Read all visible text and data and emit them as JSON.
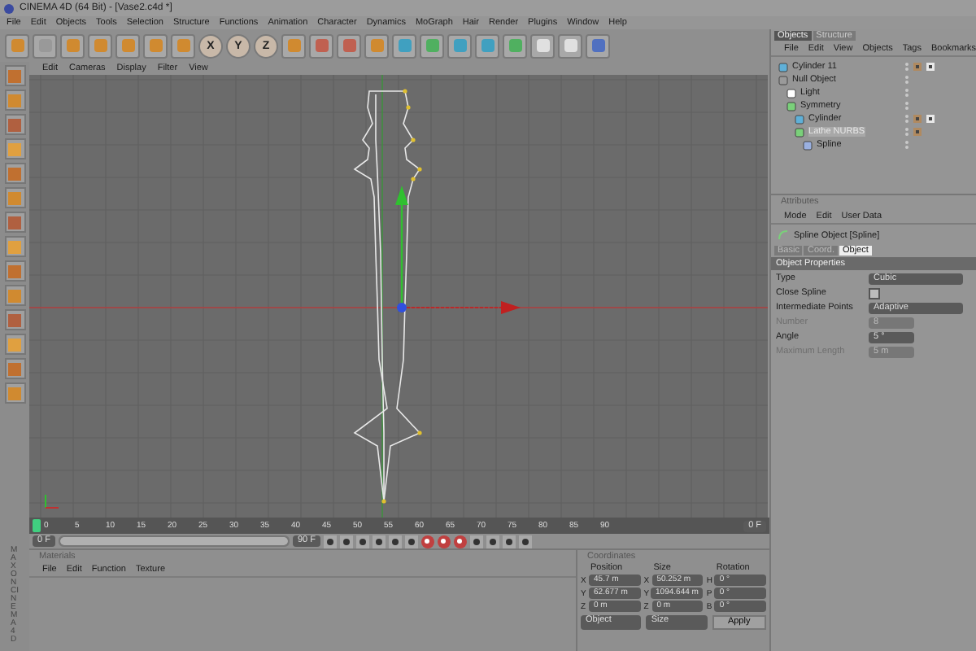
{
  "window": {
    "title": "CINEMA 4D (64 Bit) - [Vase2.c4d *]"
  },
  "menu_bar": [
    "File",
    "Edit",
    "Objects",
    "Tools",
    "Selection",
    "Structure",
    "Functions",
    "Animation",
    "Character",
    "Dynamics",
    "MoGraph",
    "Hair",
    "Render",
    "Plugins",
    "Window",
    "Help"
  ],
  "toolbar": {
    "axis_buttons": [
      "X",
      "Y",
      "Z"
    ]
  },
  "viewport": {
    "menu": [
      "Edit",
      "Cameras",
      "Display",
      "Filter",
      "View"
    ]
  },
  "object_manager": {
    "tabs": [
      {
        "label": "Objects",
        "selected": true
      },
      {
        "label": "Structure",
        "selected": false
      }
    ],
    "menu": [
      "File",
      "Edit",
      "View",
      "Objects",
      "Tags",
      "Bookmarks"
    ],
    "tree": [
      {
        "name": "Cylinder 11",
        "kind": "cylinder",
        "selected": false,
        "tags": [
          {
            "kind": "material"
          },
          {
            "kind": "phong"
          }
        ]
      },
      {
        "name": "Null Object",
        "kind": "null",
        "selected": false,
        "children": [
          {
            "name": "Light",
            "kind": "light",
            "selected": false
          },
          {
            "name": "Symmetry",
            "kind": "symmetry",
            "selected": false,
            "children": [
              {
                "name": "Cylinder",
                "kind": "cylinder",
                "selected": false,
                "tags": [
                  {
                    "kind": "material"
                  },
                  {
                    "kind": "phong"
                  }
                ]
              },
              {
                "name": "Lathe NURBS",
                "kind": "lathe",
                "selected": true,
                "tags": [
                  {
                    "kind": "material"
                  }
                ],
                "children": [
                  {
                    "name": "Spline",
                    "kind": "spline",
                    "selected": false
                  }
                ]
              }
            ]
          }
        ]
      }
    ]
  },
  "attributes": {
    "title": "Attributes",
    "menu": [
      "Mode",
      "Edit",
      "User Data"
    ],
    "object": "Spline Object [Spline]",
    "tabs": [
      {
        "label": "Basic",
        "selected": false
      },
      {
        "label": "Coord.",
        "selected": false
      },
      {
        "label": "Object",
        "selected": true
      }
    ],
    "section": "Object Properties",
    "fields": [
      {
        "label": "Type",
        "kind": "dropdown",
        "value": "Cubic",
        "disabled": false
      },
      {
        "label": "Close Spline",
        "kind": "checkbox",
        "checked": false,
        "disabled": false
      },
      {
        "label": "Intermediate Points",
        "kind": "dropdown",
        "value": "Adaptive",
        "disabled": false
      },
      {
        "label": "Number",
        "kind": "number",
        "value": "8",
        "disabled": true
      },
      {
        "label": "Angle",
        "kind": "number",
        "value": "5 °",
        "disabled": false
      },
      {
        "label": "Maximum Length",
        "kind": "number",
        "value": "5 m",
        "disabled": true
      }
    ]
  },
  "timeline": {
    "ticks": [
      "0",
      "5",
      "10",
      "15",
      "20",
      "25",
      "30",
      "35",
      "40",
      "45",
      "50",
      "55",
      "60",
      "65",
      "70",
      "75",
      "80",
      "85",
      "90"
    ],
    "current_frame": "0 F",
    "start_field": "0 F",
    "end_field": "90 F",
    "frame_range": {
      "level": 1
    }
  },
  "materials": {
    "title": "Materials",
    "menu": [
      "File",
      "Edit",
      "Function",
      "Texture"
    ]
  },
  "coordinates": {
    "title": "Coordinates",
    "columns": [
      {
        "heading": "Position",
        "rows": [
          {
            "axis": "X",
            "value": "45.7 m"
          },
          {
            "axis": "Y",
            "value": "62.677 m"
          },
          {
            "axis": "Z",
            "value": "0 m"
          }
        ]
      },
      {
        "heading": "Size",
        "rows": [
          {
            "axis": "X",
            "value": "50.252 m"
          },
          {
            "axis": "Y",
            "value": "1094.644 m"
          },
          {
            "axis": "Z",
            "value": "0 m"
          }
        ]
      },
      {
        "heading": "Rotation",
        "rows": [
          {
            "axis": "H",
            "value": "0 °"
          },
          {
            "axis": "P",
            "value": "0 °"
          },
          {
            "axis": "B",
            "value": "0 °"
          }
        ]
      }
    ],
    "dropdowns": [
      "Object",
      "Size"
    ],
    "apply": "Apply"
  },
  "branding": "MAXON CINEMA 4D"
}
